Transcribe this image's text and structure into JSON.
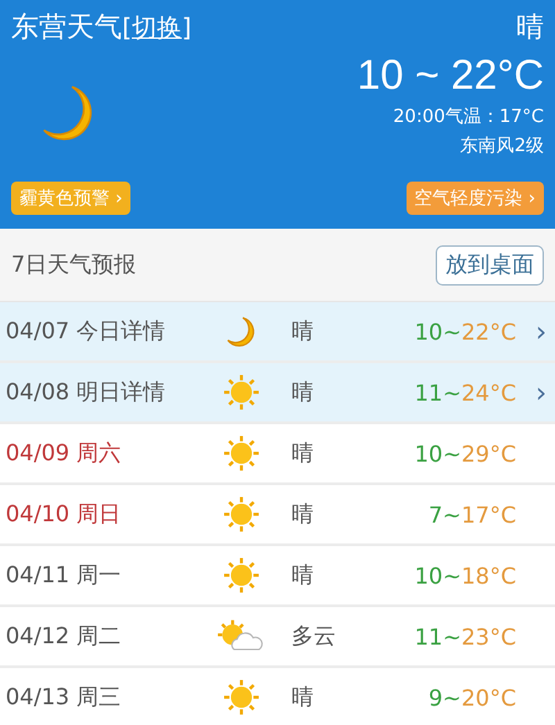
{
  "header": {
    "city": "东营天气",
    "switch_link": "[切换]",
    "condition": "晴",
    "temp_range": "10 ~ 22°C",
    "current_temp": "20:00气温：17°C",
    "wind": "东南风2级",
    "warning_badge": "霾黄色预警 ›",
    "air_badge": "空气轻度污染 ›"
  },
  "forecast": {
    "title": "7日天气预报",
    "desktop_button": "放到桌面",
    "rows": [
      {
        "date": "04/07",
        "day": "今日详情",
        "kind": "night",
        "condition": "晴",
        "low": "10~",
        "high": "22°C",
        "weekend": false,
        "detail": true,
        "chevron": "›"
      },
      {
        "date": "04/08",
        "day": "明日详情",
        "kind": "sunny",
        "condition": "晴",
        "low": "11~",
        "high": "24°C",
        "weekend": false,
        "detail": true,
        "chevron": "›"
      },
      {
        "date": "04/09",
        "day": "周六",
        "kind": "sunny",
        "condition": "晴",
        "low": "10~",
        "high": "29°C",
        "weekend": true,
        "detail": false
      },
      {
        "date": "04/10",
        "day": "周日",
        "kind": "sunny",
        "condition": "晴",
        "low": "7~",
        "high": "17°C",
        "weekend": true,
        "detail": false
      },
      {
        "date": "04/11",
        "day": "周一",
        "kind": "sunny",
        "condition": "晴",
        "low": "10~",
        "high": "18°C",
        "weekend": false,
        "detail": false
      },
      {
        "date": "04/12",
        "day": "周二",
        "kind": "cloudy",
        "condition": "多云",
        "low": "11~",
        "high": "23°C",
        "weekend": false,
        "detail": false
      },
      {
        "date": "04/13",
        "day": "周三",
        "kind": "sunny",
        "condition": "晴",
        "low": "9~",
        "high": "20°C",
        "weekend": false,
        "detail": false
      }
    ]
  }
}
